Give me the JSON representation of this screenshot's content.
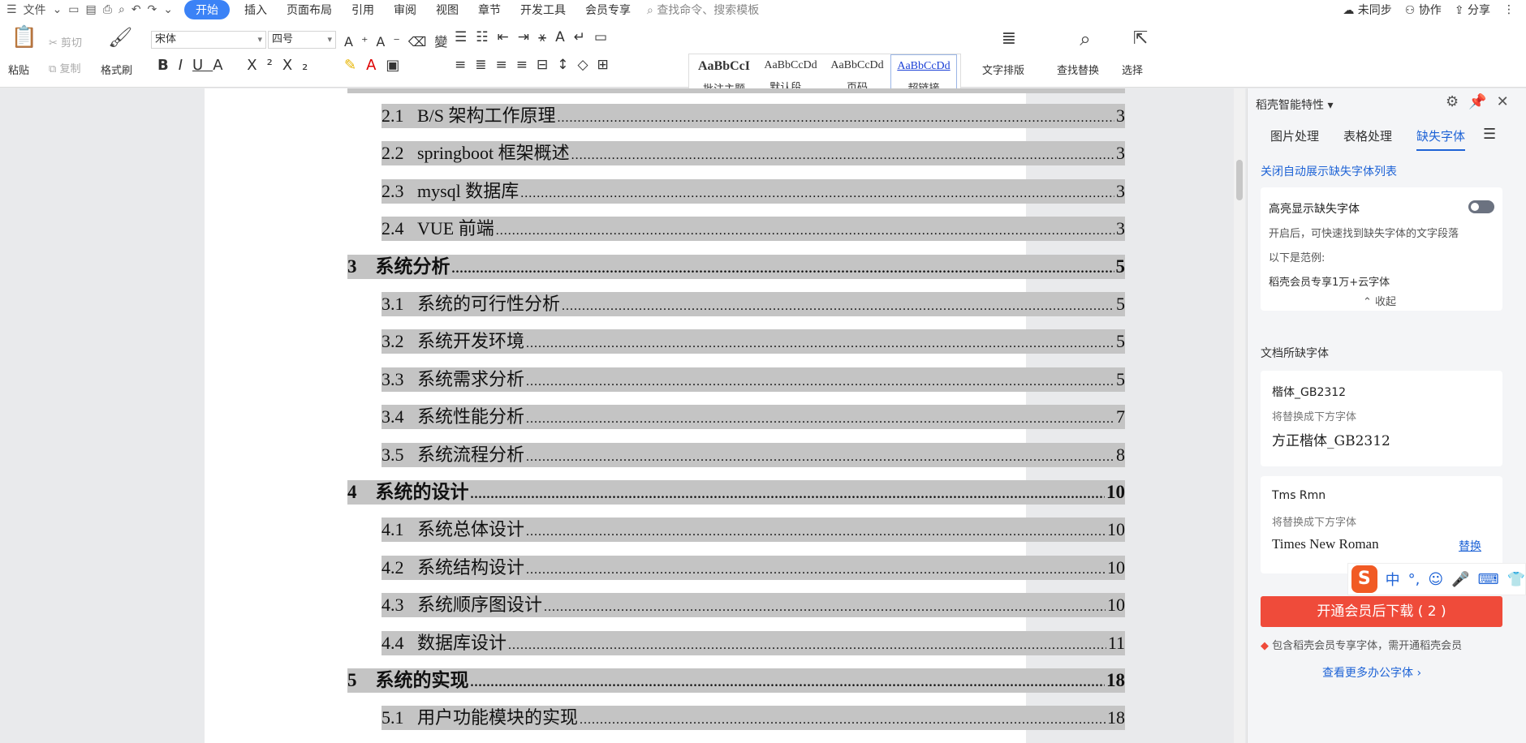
{
  "menubar": {
    "file_label": "文件",
    "tabs": [
      "开始",
      "插入",
      "页面布局",
      "引用",
      "审阅",
      "视图",
      "章节",
      "开发工具",
      "会员专享"
    ],
    "active_tab": "开始",
    "search_placeholder": "查找命令、搜索模板",
    "right": {
      "sync": "未同步",
      "collab": "协作",
      "share": "分享"
    }
  },
  "ribbon": {
    "paste": "粘贴",
    "cut": "剪切",
    "copy": "复制",
    "format_painter": "格式刷",
    "font_name": "宋体",
    "font_size": "四号",
    "styles": [
      {
        "sample": "AaBbCcI",
        "name": "批注主题"
      },
      {
        "sample": "AaBbCcDd",
        "name": "默认段..."
      },
      {
        "sample": "AaBbCcDd",
        "name": "页码"
      },
      {
        "sample": "AaBbCcDd",
        "name": "超链接"
      }
    ],
    "text_layout": "文字排版",
    "find_replace": "查找替换",
    "select": "选择"
  },
  "toc": [
    {
      "num": "2.1",
      "title": "B/S 架构工作原理",
      "page": "3",
      "level": 2
    },
    {
      "num": "2.2",
      "title": "springboot 框架概述",
      "page": "3",
      "level": 2
    },
    {
      "num": "2.3",
      "title": "mysql 数据库",
      "page": "3",
      "level": 2
    },
    {
      "num": "2.4",
      "title": "VUE 前端",
      "page": "3",
      "level": 2
    },
    {
      "num": "3",
      "title": "系统分析",
      "page": "5",
      "level": 1
    },
    {
      "num": "3.1",
      "title": "系统的可行性分析",
      "page": "5",
      "level": 2
    },
    {
      "num": "3.2",
      "title": "系统开发环境",
      "page": "5",
      "level": 2
    },
    {
      "num": "3.3",
      "title": "系统需求分析",
      "page": "5",
      "level": 2
    },
    {
      "num": "3.4",
      "title": "系统性能分析",
      "page": "7",
      "level": 2
    },
    {
      "num": "3.5",
      "title": "系统流程分析",
      "page": "8",
      "level": 2
    },
    {
      "num": "4",
      "title": "系统的设计",
      "page": "10",
      "level": 1
    },
    {
      "num": "4.1",
      "title": "系统总体设计",
      "page": "10",
      "level": 2
    },
    {
      "num": "4.2",
      "title": "系统结构设计",
      "page": "10",
      "level": 2
    },
    {
      "num": "4.3",
      "title": "系统顺序图设计",
      "page": "10",
      "level": 2
    },
    {
      "num": "4.4",
      "title": "数据库设计",
      "page": "11",
      "level": 2
    },
    {
      "num": "5",
      "title": "系统的实现",
      "page": "18",
      "level": 1
    },
    {
      "num": "5.1",
      "title": "用户功能模块的实现",
      "page": "18",
      "level": 2
    }
  ],
  "panel": {
    "title": "稻壳智能特性",
    "tabs": [
      "图片处理",
      "表格处理",
      "缺失字体"
    ],
    "active_tab": "缺失字体",
    "close_auto": "关闭自动展示缺失字体列表",
    "highlight_title": "高亮显示缺失字体",
    "highlight_desc": "开启后，可快速找到缺失字体的文字段落",
    "example_label": "以下是范例:",
    "example_text": "稻壳会员专享1万+云字体",
    "collapse": "收起",
    "missing_header": "文档所缺字体",
    "fonts": [
      {
        "missing": "楷体_GB2312",
        "note": "将替换成下方字体",
        "replacement": "方正楷体_GB2312",
        "action": ""
      },
      {
        "missing": "Tms Rmn",
        "note": "将替换成下方字体",
        "replacement": "Times New Roman",
        "action": "替换"
      }
    ],
    "download_button": "开通会员后下载 ( 2 )",
    "vip_note": "包含稻壳会员专享字体，需开通稻壳会员",
    "more_link": "查看更多办公字体 ›"
  },
  "ime": {
    "lang": "中"
  }
}
